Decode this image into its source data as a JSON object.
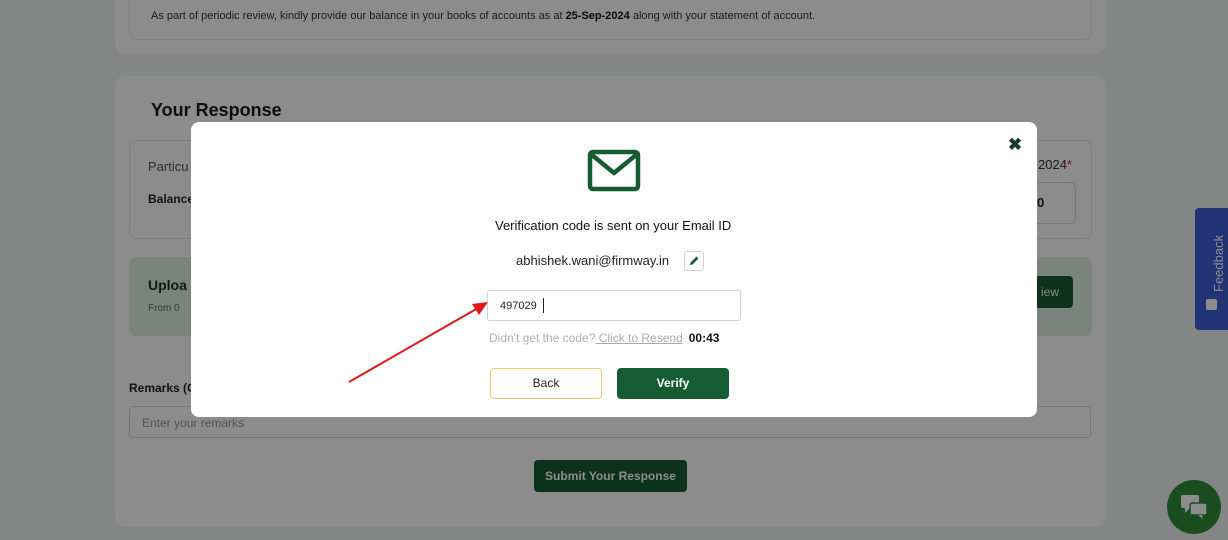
{
  "intro": {
    "text_before": "As part of periodic review, kindly provide our balance in your books of accounts as at ",
    "date": "25-Sep-2024",
    "text_after": " along with your statement of account."
  },
  "response": {
    "title": "Your Response",
    "particulars_label": "Particu",
    "balance_label": "Balance",
    "as_at_label": "2024",
    "required_mark": "*",
    "balance_value": "0"
  },
  "upload": {
    "title": "Uploa",
    "subtitle": "From  0",
    "button_label": "iew"
  },
  "remarks": {
    "label": "Remarks (C",
    "placeholder": "Enter your remarks"
  },
  "submit_label": "Submit Your Response",
  "feedback_label": "Feedback",
  "modal": {
    "close_symbol": "✖",
    "message": "Verification code is sent on your Email ID",
    "email": "abhishek.wani@firmway.in",
    "code_value": "497029",
    "resend_question": "Didn't get the code?",
    "resend_link": " Click to Resend",
    "timer": "00:43",
    "back_label": "Back",
    "verify_label": "Verify"
  },
  "colors": {
    "primary_green": "#165c33",
    "annotation_red": "#e01818",
    "feedback_blue": "#3d5bd6",
    "chat_green": "#2f8d3a"
  },
  "icons": [
    "mail-icon",
    "edit-pencil-icon",
    "close-icon",
    "feedback-icon",
    "chat-icon"
  ]
}
